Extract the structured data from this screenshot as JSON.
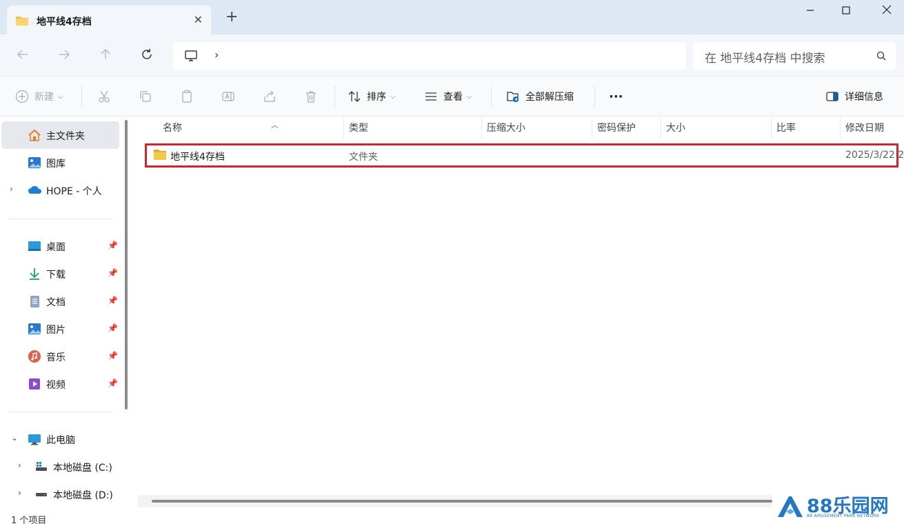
{
  "tab": {
    "title": "地平线4存档"
  },
  "address": {
    "location_icon": "computer-icon"
  },
  "search": {
    "placeholder": "在 地平线4存档 中搜索"
  },
  "toolbar": {
    "new_label": "新建",
    "sort_label": "排序",
    "view_label": "查看",
    "extract_label": "全部解压缩",
    "more_label": "···",
    "details_label": "详细信息"
  },
  "sidebar": {
    "top_items": [
      {
        "label": "主文件夹",
        "icon": "home-icon"
      },
      {
        "label": "图库",
        "icon": "gallery-icon"
      },
      {
        "label": "HOPE - 个人",
        "icon": "onedrive-icon"
      }
    ],
    "quick_items": [
      {
        "label": "桌面",
        "icon": "desktop-icon"
      },
      {
        "label": "下载",
        "icon": "download-icon"
      },
      {
        "label": "文档",
        "icon": "documents-icon"
      },
      {
        "label": "图片",
        "icon": "pictures-icon"
      },
      {
        "label": "音乐",
        "icon": "music-icon"
      },
      {
        "label": "视频",
        "icon": "videos-icon"
      }
    ],
    "pc": {
      "label": "此电脑"
    },
    "drives": [
      {
        "label": "本地磁盘 (C:)"
      },
      {
        "label": "本地磁盘 (D:)"
      }
    ]
  },
  "columns": [
    "名称",
    "类型",
    "压缩大小",
    "密码保护",
    "大小",
    "比率",
    "修改日期"
  ],
  "files": [
    {
      "name": "地平线4存档",
      "type": "文件夹",
      "modified": "2025/3/22 2"
    }
  ],
  "status": {
    "item_count": "1 个项目"
  },
  "watermark": {
    "title": "88乐园网",
    "subtitle": "88 AMUSEMENT PARK NETWORK"
  },
  "colors": {
    "accent": "#0067c0",
    "highlight_border": "#d2232a",
    "folder": "#f4c04b",
    "watermark": "#2276c7"
  }
}
